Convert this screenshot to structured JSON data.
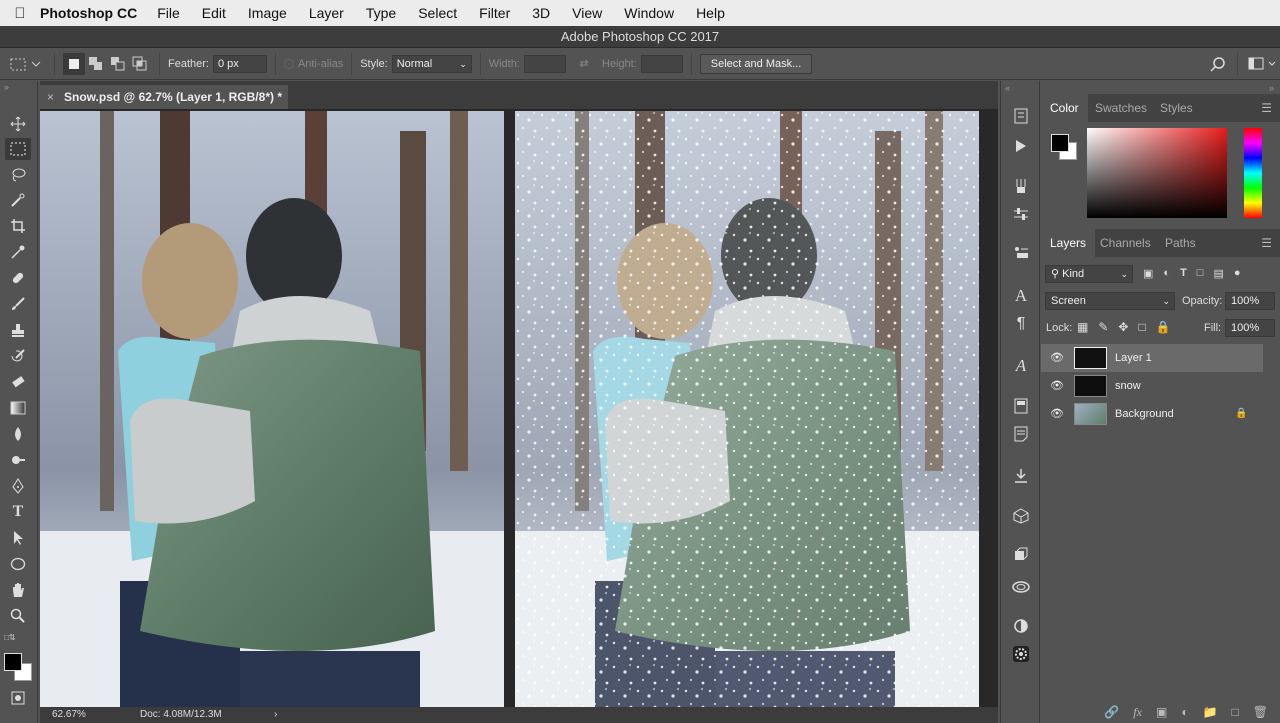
{
  "menubar": {
    "app_name": "Photoshop CC",
    "items": [
      "File",
      "Edit",
      "Image",
      "Layer",
      "Type",
      "Select",
      "Filter",
      "3D",
      "View",
      "Window",
      "Help"
    ]
  },
  "window_title": "Adobe Photoshop CC 2017",
  "options_bar": {
    "feather_label": "Feather:",
    "feather_value": "0 px",
    "anti_alias_label": "Anti-alias",
    "style_label": "Style:",
    "style_value": "Normal",
    "width_label": "Width:",
    "height_label": "Height:",
    "select_mask_label": "Select and Mask..."
  },
  "document": {
    "tab_title": "Snow.psd @ 62.7% (Layer 1, RGB/8*) *",
    "close_glyph": "×"
  },
  "status_bar": {
    "zoom": "62.67%",
    "doc_info": "Doc: 4.08M/12.3M",
    "arrow": "›"
  },
  "color_panel": {
    "tabs": [
      "Color",
      "Swatches",
      "Styles"
    ],
    "active_tab": "Color"
  },
  "layers_panel": {
    "tabs": [
      "Layers",
      "Channels",
      "Paths"
    ],
    "filter_kind": "Kind",
    "blend_mode": "Screen",
    "opacity_label": "Opacity:",
    "opacity_value": "100%",
    "lock_label": "Lock:",
    "fill_label": "Fill:",
    "fill_value": "100%",
    "layers": [
      {
        "name": "Layer 1",
        "selected": true,
        "locked": false
      },
      {
        "name": "snow",
        "selected": false,
        "locked": false
      },
      {
        "name": "Background",
        "selected": false,
        "locked": true
      }
    ]
  },
  "colors": {
    "panel_bg": "#535353",
    "dark_bg": "#3c3c3c",
    "menubar_bg": "#ececec",
    "selected_layer": "#6a6a6a"
  }
}
